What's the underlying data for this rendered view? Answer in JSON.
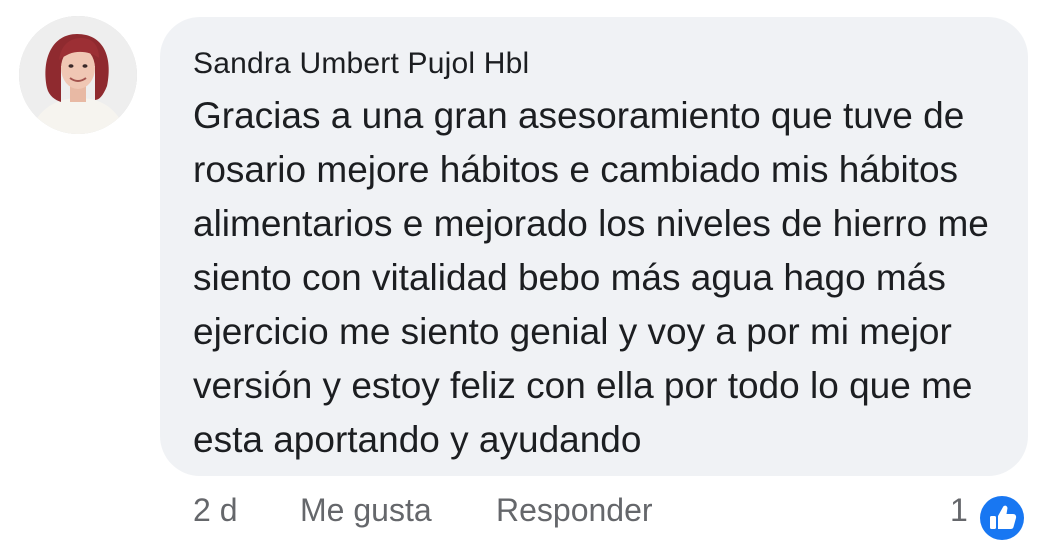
{
  "comment": {
    "author": "Sandra Umbert Pujol Hbl",
    "text": "Gracias a una gran asesoramiento que tuve de rosario mejore hábitos e cambiado mis hábitos alimentarios e mejorado los niveles de hierro me siento con vitalidad bebo más agua hago más ejercicio me siento genial y voy a por mi mejor versión y estoy feliz con ella por todo lo que me esta aportando y ayudando",
    "avatar_icon": "profile-photo",
    "bubble_color": "#f0f2f5"
  },
  "actions": {
    "time": "2 d",
    "like_label": "Me gusta",
    "reply_label": "Responder"
  },
  "reactions": {
    "count": "1",
    "icon": "thumbs-up-icon",
    "color": "#1877f2"
  }
}
